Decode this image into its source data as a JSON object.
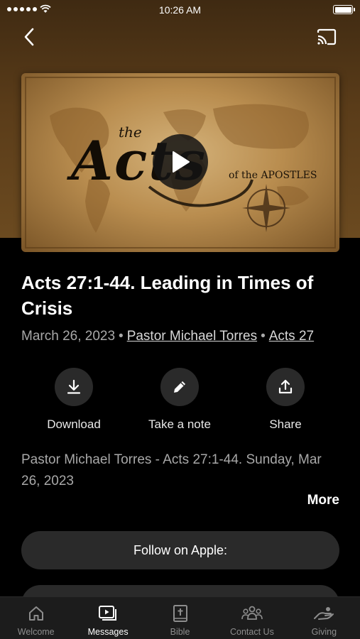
{
  "status_bar": {
    "time": "10:26 AM"
  },
  "artwork": {
    "title_small": "the",
    "title_big": "Acts",
    "title_sub": "of the APOSTLES"
  },
  "sermon": {
    "title": "Acts 27:1-44. Leading in Times of Crisis",
    "date": "March 26, 2023",
    "separator": "•",
    "speaker": "Pastor Michael Torres",
    "series": "Acts 27",
    "description": "Pastor Michael Torres - Acts 27:1-44. Sunday, Mar 26, 2023",
    "more_label": "More"
  },
  "actions": [
    {
      "label": "Download",
      "icon": "download-icon"
    },
    {
      "label": "Take a note",
      "icon": "pencil-icon"
    },
    {
      "label": "Share",
      "icon": "share-icon"
    }
  ],
  "follow": {
    "apple_label": "Follow on Apple:"
  },
  "tabs": [
    {
      "label": "Welcome",
      "icon": "home-icon",
      "active": false
    },
    {
      "label": "Messages",
      "icon": "video-icon",
      "active": true
    },
    {
      "label": "Bible",
      "icon": "bible-icon",
      "active": false
    },
    {
      "label": "Contact Us",
      "icon": "people-icon",
      "active": false
    },
    {
      "label": "Giving",
      "icon": "giving-hand-icon",
      "active": false
    }
  ],
  "colors": {
    "background": "#000000",
    "header_brown": "#5a3c19",
    "button_gray": "#2a2a2a",
    "muted_text": "#a8a8a8"
  }
}
